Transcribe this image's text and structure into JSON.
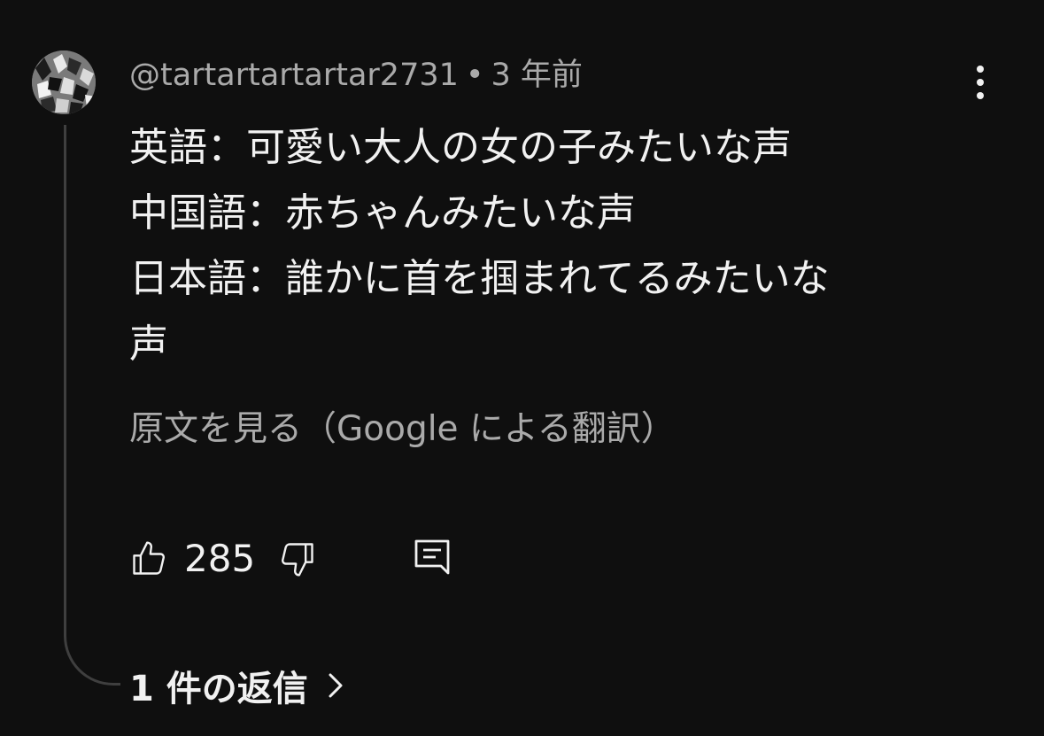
{
  "comment": {
    "author": "@tartartartartar2731",
    "separator": "•",
    "posted_ago": "3 年前",
    "body": "英語：可愛い大人の女の子みたいな声\n中国語：赤ちゃんみたいな声\n日本語：誰かに首を掴まれてるみたいな\n声",
    "translate_link": "原文を見る（Google による翻訳）",
    "like_count": "285",
    "replies_label": "1 件の返信"
  },
  "icons": {
    "like": "thumbs-up-icon",
    "dislike": "thumbs-down-icon",
    "reply": "reply-comment-icon",
    "menu": "more-vertical-icon",
    "replies_chevron": "chevron-right-icon"
  },
  "colors": {
    "background": "#0f0f0f",
    "primary_text": "#f1f1f1",
    "secondary_text": "#aaaaaa",
    "thread_line": "#3f3f3f"
  }
}
